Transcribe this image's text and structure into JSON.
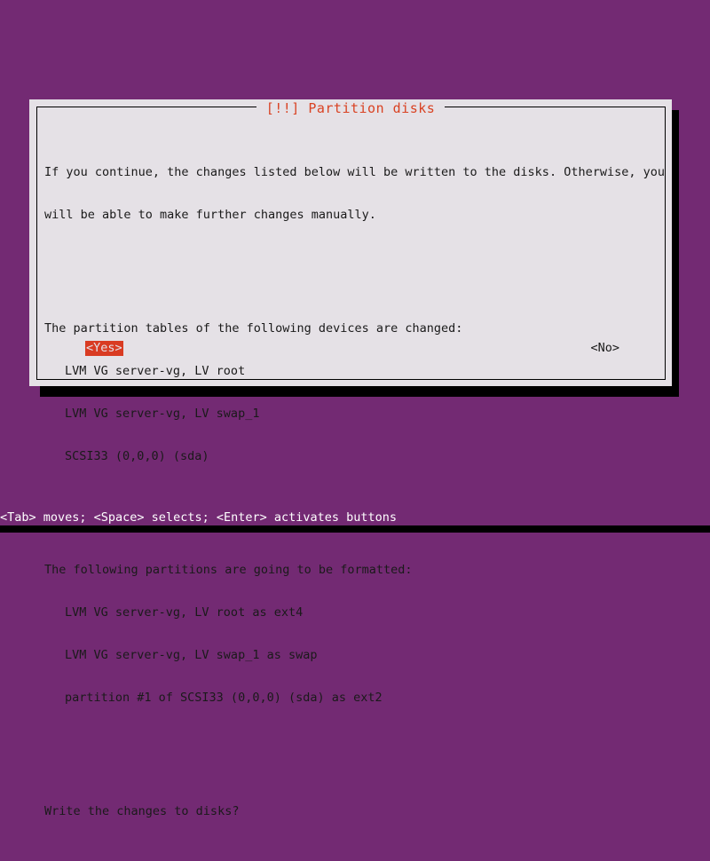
{
  "screen": {
    "background_color": "#732a73",
    "bottom_strip_color": "#000000"
  },
  "dialog": {
    "title": "[!!] Partition disks",
    "title_color": "#d94222",
    "background_color": "#e5e1e6",
    "border_color": "#000000",
    "shadow_color": "#000000",
    "intro": {
      "line1": "If you continue, the changes listed below will be written to the disks. Otherwise, you",
      "line2": "will be able to make further changes manually."
    },
    "changed_section": {
      "heading": "The partition tables of the following devices are changed:",
      "items": [
        "LVM VG server-vg, LV root",
        "LVM VG server-vg, LV swap_1",
        "SCSI33 (0,0,0) (sda)"
      ]
    },
    "format_section": {
      "heading": "The following partitions are going to be formatted:",
      "items": [
        "LVM VG server-vg, LV root as ext4",
        "LVM VG server-vg, LV swap_1 as swap",
        "partition #1 of SCSI33 (0,0,0) (sda) as ext2"
      ]
    },
    "question": "Write the changes to disks?",
    "buttons": {
      "yes": {
        "label": "<Yes>",
        "selected": true,
        "background_color": "#d93b22",
        "text_color": "#e5e1e6"
      },
      "no": {
        "label": "<No>",
        "selected": false,
        "text_color": "#1a1a1a"
      }
    }
  },
  "status_bar": {
    "text": "<Tab> moves; <Space> selects; <Enter> activates buttons",
    "text_color": "#ffffff"
  }
}
